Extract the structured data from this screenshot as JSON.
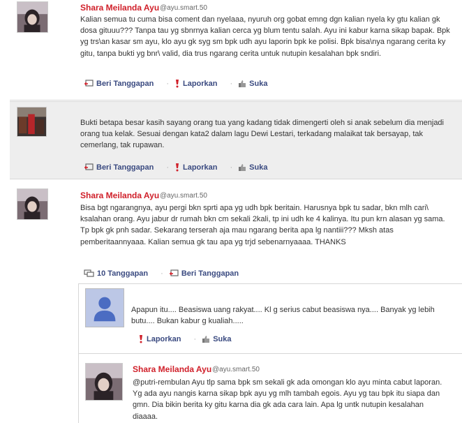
{
  "comments": [
    {
      "name": "Shara Meilanda Ayu",
      "handle": "@ayu.smart.50",
      "text": "Kalian semua tu cuma bisa coment dan nyelaaa, nyuruh org gobat emng dgn kalian nyela ky gtu kalian gk dosa gituuu??? Tanpa tau yg sbnrnya kalian cerca yg blum tentu salah. Ayu ini kabur karna sikap bapak. Bpk yg trs\\an kasar sm ayu, klo ayu gk syg sm bpk udh ayu laporin bpk ke polisi. Bpk bisa\\nya ngarang cerita ky gitu, tanpa bukti yg bnr\\ valid, dia trus ngarang cerita untuk nutupin kesalahan bpk sndiri.",
      "reply_label": "Beri Tanggapan",
      "report_label": "Laporkan",
      "like_label": "Suka"
    },
    {
      "name": "",
      "handle": "",
      "text": "Bukti betapa besar kasih sayang orang tua yang kadang tidak dimengerti oleh si anak sebelum dia menjadi orang tua kelak. Sesuai dengan kata2 dalam lagu Dewi Lestari, terkadang malaikat tak bersayap, tak cemerlang, tak rupawan.",
      "reply_label": "Beri Tanggapan",
      "report_label": "Laporkan",
      "like_label": "Suka"
    },
    {
      "name": "Shara Meilanda Ayu",
      "handle": "@ayu.smart.50",
      "text": "Bisa bgt ngarangnya, ayu pergi bkn sprti apa yg udh bpk beritain. Harusnya bpk tu sadar, bkn mlh cari\\ ksalahan orang. Ayu jabur dr rumah bkn cm sekali 2kali, tp ini udh ke 4 kalinya. Itu pun krn alasan yg sama. Tp bpk gk pnh sadar. Sekarang terserah aja mau ngarang berita apa lg nantiii??? Mksh atas pemberitaannyaaa. Kalian semua gk tau apa yg trjd sebenarnyaaaa. THANKS",
      "replies_count_label": "10 Tanggapan",
      "reply_label": "Beri Tanggapan"
    }
  ],
  "replies": [
    {
      "name": "",
      "text": "Apapun itu.... Beasiswa uang rakyat.... Kl g serius cabut beasiswa nya.... Banyak yg lebih butu.... Bukan kabur g kualiah.....",
      "report_label": "Laporkan",
      "like_label": "Suka"
    },
    {
      "name": "Shara Meilanda Ayu",
      "handle": "@ayu.smart.50",
      "text": "@putri-rembulan Ayu tlp sama bpk sm sekali gk ada omongan klo ayu minta cabut laporan. Yg ada ayu nangis karna sikap bpk ayu yg mlh tambah egois. Ayu yg tau bpk itu siapa dan gmn. Dia bikin berita ky gitu karna dia gk ada cara lain. Apa lg untk nutupin kesalahan diaaaa."
    }
  ],
  "colors": {
    "name_red": "#d0202a",
    "action_blue": "#3a4a80",
    "highlight_bg": "#eeeeee"
  },
  "icons": [
    "avatar-photo",
    "reply-icon",
    "report-icon",
    "like-icon",
    "comments-icon",
    "default-avatar-icon"
  ]
}
